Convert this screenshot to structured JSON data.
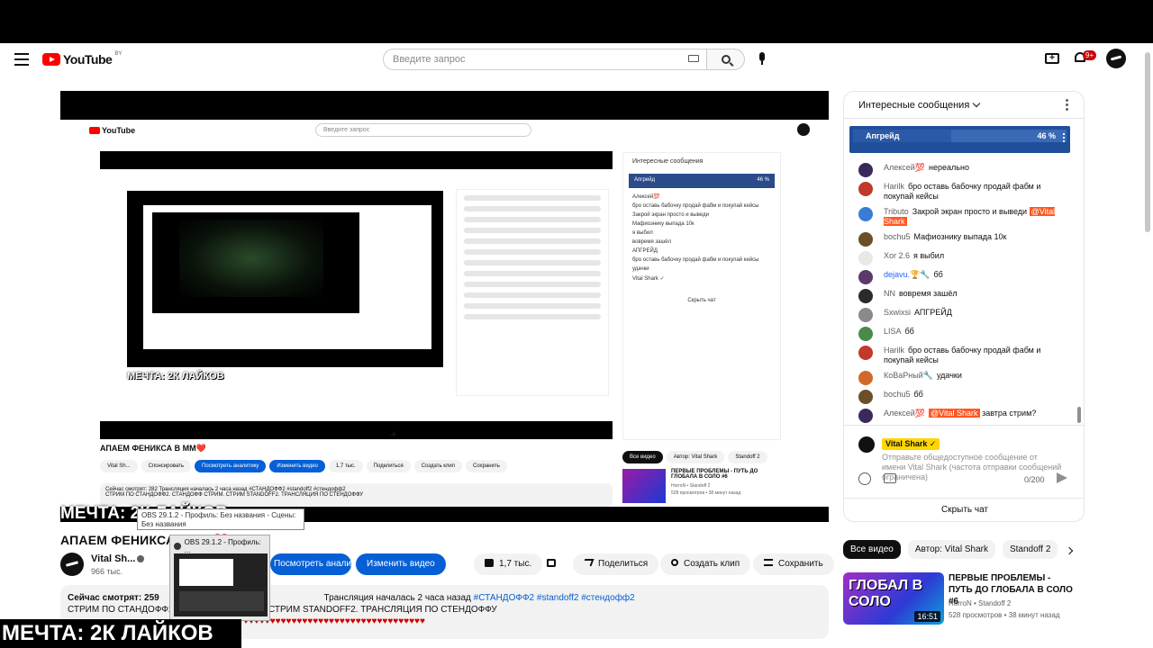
{
  "header": {
    "logo_text": "YouTube",
    "logo_country": "BY",
    "search_placeholder": "Введите запрос",
    "notifications_badge": "9+"
  },
  "player": {
    "nested_title": "АПАЕМ ФЕНИКСА В ММ❤️",
    "nested_meme": "МЕЧТА: 2К ЛАЙКОВ",
    "nested_search": "Введите запрос",
    "nested_chat_header": "Интересные сообщения",
    "nested_poll": "Апгрейд",
    "nested_poll_pct": "46 %",
    "nested_buttons": [
      "Спонсировать",
      "Посмотреть аналитику",
      "Изменить видео",
      "1,7 тыс.",
      "Поделиться",
      "Создать клип",
      "Сохранить"
    ],
    "nested_desc": "Сейчас смотрят: 282  Трансляция началась 2 часа назад  #СТАНДОФФ2 #standoff2 #стендофф2",
    "nested_side_chips": [
      "Все видео",
      "Автор: Vital Shark",
      "Standoff 2"
    ],
    "nested_channel": "Vital Sh...",
    "nested_subs": "966 тыс.",
    "nested_rec_title": "ПЕРВЫЕ ПРОБЛЕМЫ - ПУТЬ ДО ГЛОБАЛА В СОЛО #6",
    "nested_rec_channel": "HorroN • Standoff 2",
    "nested_rec_meta": "528 просмотров • 38 минут назад",
    "nested_hide_chat": "Скрыть чат",
    "progress": 1.0
  },
  "overlay": {
    "meme_top": "МЕЧТА: 2К ЛАЙКОВ",
    "obs_tooltip": "OBS 29.1.2 - Профиль: Без названия - Сцены: Без названия",
    "obs_card_title": "OBS 29.1.2 - Профиль: ...",
    "meme_bottom": "МЕЧТА: 2К ЛАЙКОВ"
  },
  "video": {
    "title": "АПАЕМ ФЕНИКСА В ММ❤️",
    "channel": "Vital Sh...",
    "subscribers": "966 тыс.",
    "analytics_button": "Посмотреть аналитику",
    "edit_button": "Изменить видео",
    "likes": "1,7 тыс.",
    "share": "Поделиться",
    "clip": "Создать клип",
    "save": "Сохранить",
    "desc_viewers": "Сейчас смотрят: 259",
    "desc_started": "Трансляция началась 2 часа назад",
    "desc_tags": "#СТАНДОФФ2 #standoff2 #стендофф2",
    "desc_line2": "СТРИМ ПО СТАНДОФФ2. СТАНДОФФ СТРИМ. СТРИМ STANDOFF2. ТРАНСЛЯЦИЯ ПО СТЕНДОФФУ",
    "hearts": "♥♥♥♥♥♥♥♥♥♥♥♥♥♥♥♥♥♥♥♥♥♥♥♥♥♥♥♥♥♥♥♥♥♥"
  },
  "chat": {
    "header": "Интересные сообщения",
    "poll_label": "Апгрейд",
    "poll_pct": "46 %",
    "poll_fraction": 0.46,
    "messages": [
      {
        "author": "Алексей💯",
        "text": "нереально",
        "color": "#3a2a5a",
        "mention": ""
      },
      {
        "author": "Harilk",
        "text": "бро оставь бабочку продай фабм и покупай кейсы",
        "color": "#c0392b",
        "mention": ""
      },
      {
        "author": "Tributo",
        "text": "Закрой экран просто и выведи",
        "color": "#3a7bd5",
        "mention": "@Vital Shark"
      },
      {
        "author": "bochu5",
        "text": "Мафиознику выпада 10к",
        "color": "#6b4f2a",
        "mention": ""
      },
      {
        "author": "Xor 2.6",
        "text": "я выбил",
        "color": "#e8e8e8",
        "mention": ""
      },
      {
        "author": "dejavu.🏆🔧",
        "text": "бб",
        "color": "#5a3a6a",
        "mention": ""
      },
      {
        "author": "NN",
        "text": "вовремя зашёл",
        "color": "#2a2a2a",
        "mention": ""
      },
      {
        "author": "Sxwixsi",
        "text": "АПГРЕЙД",
        "color": "#8a8a8a",
        "mention": ""
      },
      {
        "author": "LISA",
        "text": "бб",
        "color": "#4a8a4a",
        "mention": ""
      },
      {
        "author": "Harilk",
        "text": "бро оставь бабочку продай фабм и покупай кейсы",
        "color": "#c0392b",
        "mention": ""
      },
      {
        "author": "КоВаРный🔧",
        "text": "удачки",
        "color": "#d06a2a",
        "mention": ""
      },
      {
        "author": "bochu5",
        "text": "бб",
        "color": "#6b4f2a",
        "mention": ""
      },
      {
        "author": "Алексей💯",
        "text": "завтра стрим?",
        "color": "#3a2a5a",
        "mention": "@Vital Shark"
      }
    ],
    "input_name": "Vital Shark ✓",
    "input_placeholder": "Отправьте общедоступное сообщение от имени Vital Shark (частота отправки сообщений ограничена)",
    "char_count": "0/200",
    "hide_chat": "Скрыть чат"
  },
  "sidebar": {
    "chips": [
      "Все видео",
      "Автор: Vital Shark",
      "Standoff 2"
    ],
    "rec": {
      "thumb_text": "ГЛОБАЛ В СОЛО",
      "duration": "16:51",
      "title": "ПЕРВЫЕ ПРОБЛЕМЫ - ПУТЬ ДО ГЛОБАЛА В СОЛО #6",
      "channel": "HorroN • Standoff 2",
      "meta": "528 просмотров • 38 минут назад"
    }
  }
}
